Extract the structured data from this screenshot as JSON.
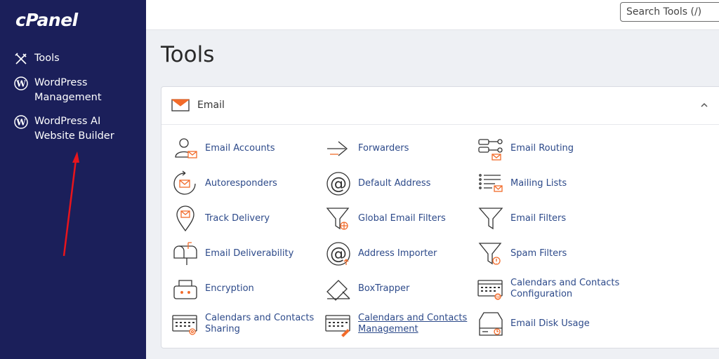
{
  "sidebar": {
    "logo": "cPanel",
    "items": [
      {
        "label": "Tools",
        "icon": "tools-icon"
      },
      {
        "label": "WordPress Management",
        "icon": "wordpress-icon"
      },
      {
        "label": "WordPress AI Website Builder",
        "icon": "wordpress-icon"
      }
    ]
  },
  "header": {
    "search_placeholder": "Search Tools (/)"
  },
  "main": {
    "title": "Tools",
    "section": {
      "title": "Email",
      "tools": [
        {
          "label": "Email Accounts",
          "icon": "email-accounts-icon"
        },
        {
          "label": "Forwarders",
          "icon": "forwarders-icon"
        },
        {
          "label": "Email Routing",
          "icon": "email-routing-icon"
        },
        {
          "label": "Autoresponders",
          "icon": "autoresponders-icon"
        },
        {
          "label": "Default Address",
          "icon": "default-address-icon"
        },
        {
          "label": "Mailing Lists",
          "icon": "mailing-lists-icon"
        },
        {
          "label": "Track Delivery",
          "icon": "track-delivery-icon"
        },
        {
          "label": "Global Email Filters",
          "icon": "global-filter-icon"
        },
        {
          "label": "Email Filters",
          "icon": "filter-icon"
        },
        {
          "label": "Email Deliverability",
          "icon": "mailbox-icon"
        },
        {
          "label": "Address Importer",
          "icon": "address-importer-icon"
        },
        {
          "label": "Spam Filters",
          "icon": "spam-filter-icon"
        },
        {
          "label": "Encryption",
          "icon": "encryption-icon"
        },
        {
          "label": "BoxTrapper",
          "icon": "boxtrapper-icon"
        },
        {
          "label": "Calendars and Contacts Configuration",
          "icon": "calendar-config-icon"
        },
        {
          "label": "Calendars and Contacts Sharing",
          "icon": "calendar-sharing-icon"
        },
        {
          "label": "Calendars and Contacts Management",
          "icon": "calendar-management-icon"
        },
        {
          "label": "Email Disk Usage",
          "icon": "disk-usage-icon"
        }
      ]
    }
  },
  "colors": {
    "sidebar_bg": "#1b1f5a",
    "accent_orange": "#f26b2a",
    "link_blue": "#2d4a8a",
    "annotation_red": "#e8141c"
  }
}
